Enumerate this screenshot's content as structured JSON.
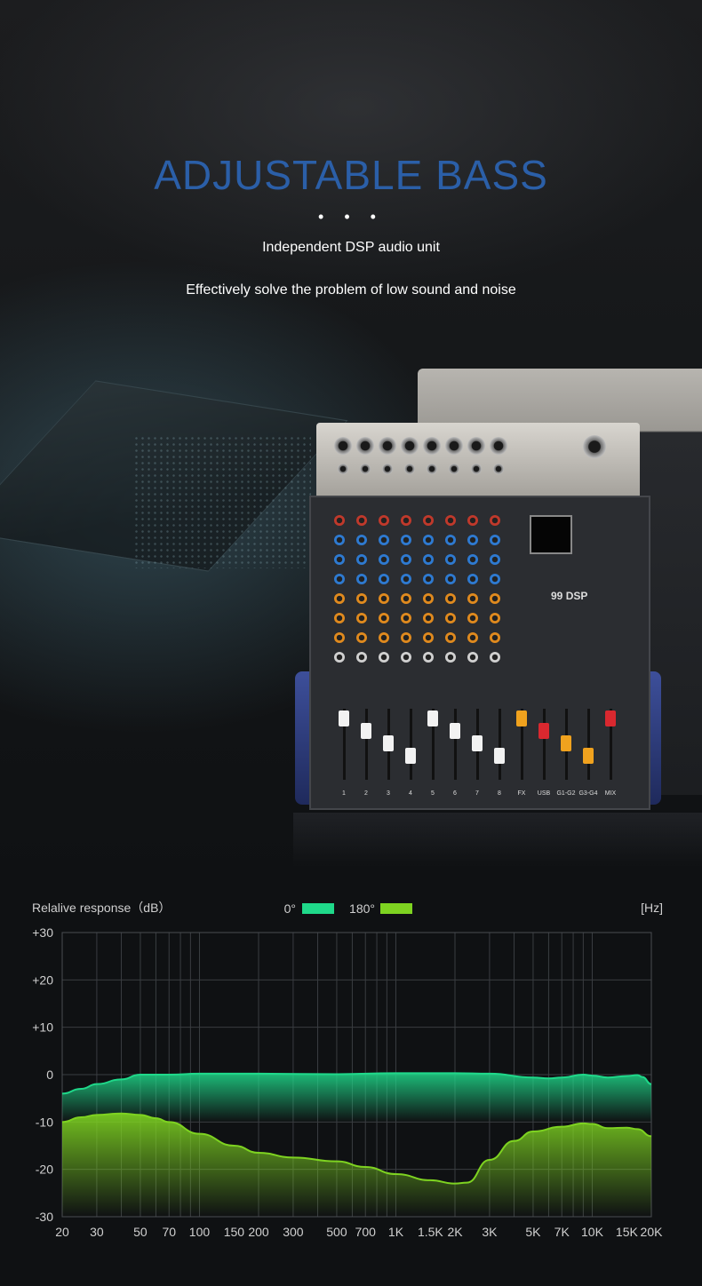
{
  "header": {
    "title": "ADJUSTABLE BASS",
    "ellipsis": "• • •",
    "subtitle": "Independent DSP audio unit",
    "description": "Effectively solve the problem of low sound and noise"
  },
  "mixer": {
    "channel_labels": [
      "1",
      "2",
      "3",
      "4",
      "5",
      "6",
      "7",
      "8",
      "FX",
      "USB",
      "G1-G2",
      "G3-G4",
      "MIX"
    ],
    "dsp_label": "DSP",
    "dsp_number": "99"
  },
  "colors": {
    "title": "#2b5fa8",
    "series_0": "#1fd98a",
    "series_180": "#7ed321"
  },
  "chart_data": {
    "type": "area",
    "ylabel": "Relalive response（dB）",
    "xunit": "[Hz]",
    "ylim": [
      -30,
      30
    ],
    "yticks": [
      "+30",
      "+20",
      "+10",
      "0",
      "-10",
      "-20",
      "-30"
    ],
    "ytick_values": [
      30,
      20,
      10,
      0,
      -10,
      -20,
      -30
    ],
    "xticks": [
      "20",
      "30",
      "50",
      "70",
      "100",
      "150",
      "200",
      "300",
      "500",
      "700",
      "1K",
      "1.5K",
      "2K",
      "3K",
      "5K",
      "7K",
      "10K",
      "15K",
      "20K"
    ],
    "xtick_values": [
      20,
      30,
      50,
      70,
      100,
      150,
      200,
      300,
      500,
      700,
      1000,
      1500,
      2000,
      3000,
      5000,
      7000,
      10000,
      15000,
      20000
    ],
    "xscale": "log",
    "grid": true,
    "legend": "top-center",
    "series": [
      {
        "name": "0°",
        "color": "#1fd98a",
        "points": [
          [
            20,
            -4
          ],
          [
            25,
            -3
          ],
          [
            30,
            -2
          ],
          [
            40,
            -1
          ],
          [
            50,
            0
          ],
          [
            70,
            0
          ],
          [
            100,
            0.2
          ],
          [
            200,
            0.2
          ],
          [
            500,
            0.1
          ],
          [
            1000,
            0.3
          ],
          [
            2000,
            0.3
          ],
          [
            3000,
            0.2
          ],
          [
            5000,
            -0.6
          ],
          [
            6000,
            -0.8
          ],
          [
            7000,
            -0.6
          ],
          [
            9000,
            0
          ],
          [
            10000,
            -0.2
          ],
          [
            12000,
            -0.6
          ],
          [
            15000,
            -0.3
          ],
          [
            17000,
            -0.1
          ],
          [
            18000,
            -0.5
          ],
          [
            20000,
            -2
          ]
        ]
      },
      {
        "name": "180°",
        "color": "#7ed321",
        "points": [
          [
            20,
            -10
          ],
          [
            25,
            -9
          ],
          [
            30,
            -8.5
          ],
          [
            40,
            -8.2
          ],
          [
            50,
            -8.5
          ],
          [
            60,
            -9.2
          ],
          [
            70,
            -10
          ],
          [
            100,
            -12.5
          ],
          [
            150,
            -15
          ],
          [
            200,
            -16.5
          ],
          [
            300,
            -17.5
          ],
          [
            500,
            -18.3
          ],
          [
            700,
            -19.5
          ],
          [
            1000,
            -21
          ],
          [
            1500,
            -22.3
          ],
          [
            2000,
            -23
          ],
          [
            2300,
            -22.8
          ],
          [
            3000,
            -18
          ],
          [
            4000,
            -14
          ],
          [
            5000,
            -12
          ],
          [
            7000,
            -11
          ],
          [
            9000,
            -10.3
          ],
          [
            10000,
            -10.4
          ],
          [
            12000,
            -11.3
          ],
          [
            15000,
            -11.2
          ],
          [
            17000,
            -11.5
          ],
          [
            20000,
            -13
          ]
        ]
      }
    ]
  }
}
